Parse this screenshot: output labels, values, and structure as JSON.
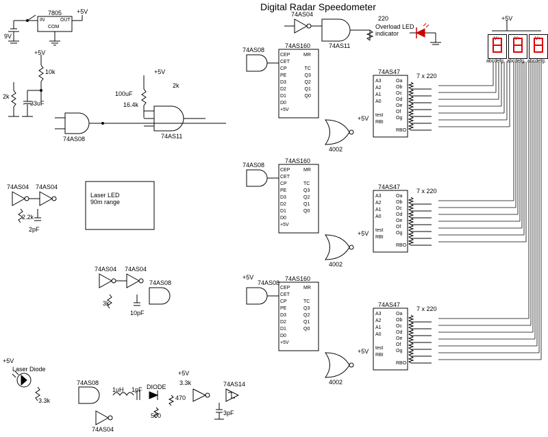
{
  "title": "Digital Radar Speedometer",
  "power": {
    "vreg": "7805",
    "vin_pin": "IN",
    "vout_pin": "OUT",
    "com_pin": "COM",
    "battery": "9V",
    "v5": "+5V"
  },
  "res": {
    "r10k": "10k",
    "r2k_a": "2k",
    "r2k_b": "2k",
    "r33uf": "33uF",
    "r100uf": "100uF",
    "r16_4k": "16.4k",
    "r220_led": "220",
    "r7x220": "7 x 220",
    "r2_2k": "2.2k",
    "r3k": "3k",
    "r3_3k_a": "3.3k",
    "r3_3k_b": "3.3k",
    "r470": "470",
    "r500": "500"
  },
  "cap": {
    "c2pf": "2pF",
    "c10pf": "10pF",
    "c1pf": "1pF",
    "c3pf": "3pF"
  },
  "ind": {
    "l1uh": "1uH"
  },
  "diode_label": "DIODE",
  "led_overload": "Overload LED\nindicator",
  "laser_led": "Laser LED\n90m range",
  "laser_diode": "Laser Diode",
  "ic": {
    "as04": "74AS04",
    "as08": "74AS08",
    "as11": "74AS11",
    "as14": "74AS14",
    "as47": "74AS47",
    "as160": "74AS160",
    "nor4002": "4002"
  },
  "counter_pins_left": [
    "CEP",
    "CET",
    "CP",
    "PE",
    "D3",
    "D2",
    "D1",
    "D0",
    "+5V"
  ],
  "counter_pins_right": [
    "MR",
    "",
    "TC",
    "Q3",
    "Q2",
    "Q1",
    "Q0"
  ],
  "decoder_pins_left": [
    "A3",
    "A2",
    "A1",
    "A0",
    "",
    "test",
    "RBI"
  ],
  "decoder_pins_right": [
    "Oa",
    "Ob",
    "Oc",
    "Od",
    "Oe",
    "Of",
    "Og",
    "",
    "RBO"
  ],
  "seg_labels": "abcdefg.",
  "seg_top": "V+"
}
